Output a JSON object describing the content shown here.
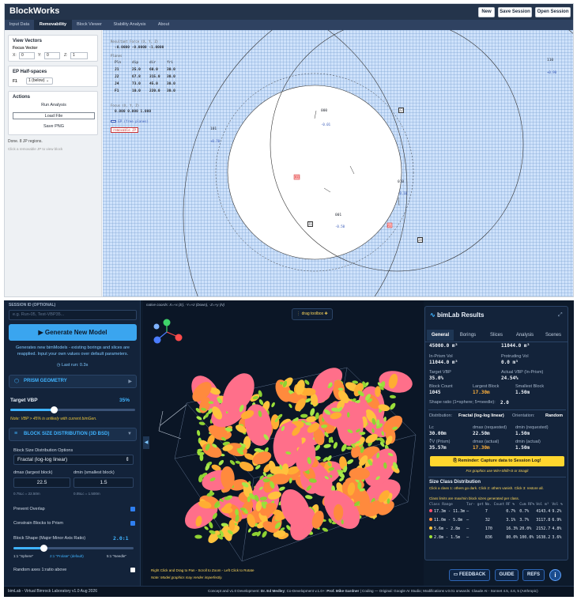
{
  "blockworks": {
    "brand": "BlockWorks",
    "header_buttons": [
      "New",
      "Save Session",
      "Open Session"
    ],
    "tabs": [
      "Input Data",
      "Removability",
      "Block Viewer",
      "Stability Analysis",
      "About"
    ],
    "active_tab": "Removability",
    "view_vectors": {
      "title": "View Vectors",
      "focus_label": "Focus Vector",
      "x_label": "X:",
      "x": "0",
      "y_label": "Y:",
      "y": "0",
      "z_label": "Z:",
      "z": "1"
    },
    "ep": {
      "title": "EP Half-spaces",
      "f1_label": "F1",
      "f1_value": "1 (below)"
    },
    "actions": {
      "title": "Actions",
      "run": "Run Analysis",
      "load": "Load File",
      "save_png": "Save PNG"
    },
    "status": "Done. 8 JP regions.",
    "hint": "Click a removable JP to view block",
    "info": {
      "resultant_label": "Resultant Force (X, Y, Z)",
      "resultant": "-0.0000   -0.0000   -1.0000",
      "planes_label": "Planes",
      "headers": [
        "Pln",
        "dip",
        "dir",
        "fri"
      ],
      "rows": [
        [
          "J1",
          "25.0",
          "60.0",
          "30.0"
        ],
        [
          "J2",
          "67.8",
          "315.0",
          "30.0"
        ],
        [
          "J4",
          "73.0",
          "45.0",
          "30.0"
        ],
        [
          "F1",
          "10.0",
          "220.0",
          "30.0"
        ]
      ],
      "focus_label": "Focus (X, Y, Z)",
      "focus": "0.000  0.000  1.000",
      "ep_legend": "EP (free planes)",
      "removable_legend": "removable JP"
    },
    "plot_labels": [
      {
        "t": "110",
        "id": "l110"
      },
      {
        "t": "+0.90",
        "id": "l090"
      },
      {
        "t": "000",
        "id": "l000"
      },
      {
        "t": "-0.01",
        "id": "l001"
      },
      {
        "t": "J2",
        "id": "lj2"
      },
      {
        "t": "101",
        "id": "l101"
      },
      {
        "t": "+0.70",
        "id": "l070"
      },
      {
        "t": "001",
        "id": "l001b"
      },
      {
        "t": "010",
        "id": "l010"
      },
      {
        "t": "-0.10",
        "id": "l010b"
      },
      {
        "t": "011",
        "id": "l011"
      },
      {
        "t": "-0.50",
        "id": "l050"
      },
      {
        "t": "J1",
        "id": "lj1"
      },
      {
        "t": "F1",
        "id": "lf1"
      },
      {
        "t": "J4",
        "id": "lj4"
      }
    ]
  },
  "bimlab": {
    "session_label": "SESSION ID (OPTIONAL)",
    "session_placeholder": "e.g. Run-05, Test-VBP35...",
    "generate": "Generate New Model",
    "generate_note": "Generates new bimModels - existing borings and slices are reapplied. Input your own values over default parameters.",
    "last_run": "Last run: 0.3s",
    "prism_section": "PRISM GEOMETRY",
    "target_vbp_label": "Target VBP",
    "target_vbp": "35%",
    "target_vbp_fraction": 0.35,
    "vbp_note": "Note: VBP > 45% is unlikely with current bimGen.",
    "bsd_section": "BLOCK SIZE DISTRIBUTION (3D BSD)",
    "bsd_options_label": "Block Size Distribution Options",
    "bsd_select": "Fractal (log-log linear)",
    "dmax_label": "dmax (largest block)",
    "dmax": "22.5",
    "dmax_hint": "0.75Lc = 22.50m",
    "dmin_label": "dmin (smallest block)",
    "dmin": "1.5",
    "dmin_hint": "0.05Lc = 1.500m",
    "prevent_overlap": "Prevent Overlap",
    "constrain": "Constrain Blocks to Prism",
    "shape_label": "Block Shape (Major:Minor Axis Ratio)",
    "shape_value": "2.0:1",
    "shape_fraction": 0.25,
    "shape_ticks": [
      "1:1 \"Sphere\"",
      "2:1 \"Prolate\" (default)",
      "5:1 \"Needle\""
    ],
    "random_axes": "Random axes 1:ratio above",
    "footer_left": "bimLab - Virtual Bimrock Laboratory v1.0 Aug 2026",
    "footer_right_1": "Concept and v1.0 Development: ",
    "footer_right_name1": "Dr. Ed Medley",
    "footer_right_2": "; Co-Development v.1.0+: ",
    "footer_right_name2": "Prof. Mike Gardner",
    "footer_right_3": " | Coding — Original: Google AI Studio; Modifications v.0.01 onwards: Claude AI - Sonnet 4.5, 4.6, 5 (Anthropic)",
    "view": {
      "coords_hint": "native coords: X=+x (E), -Y=+z (Down), -Z=+y (N)",
      "toolbox": "drag toolbox",
      "axis_labels": [
        "Y",
        "X",
        "Z",
        "X"
      ],
      "controls_hint": "Right Click and Drag to Pan - Scroll to Zoom - Left Click to Rotate",
      "model_note": "Note: Model graphics may render imperfectly."
    },
    "results": {
      "title": "bimLab Results",
      "tabs": [
        "General",
        "Borings",
        "Slices",
        "Analysis",
        "Scenes"
      ],
      "active_tab": "General",
      "top_left": "45000.0 m³",
      "top_right": "11044.0 m³",
      "in_prism_label": "In-Prism Vol",
      "in_prism": "11044.0 m³",
      "protruding_label": "Protruding Vol",
      "protruding": "0.0 m³",
      "target_vbp_label": "Target VBP",
      "target_vbp": "35.0%",
      "actual_vbp_label": "Actual VBP (In-Prism)",
      "actual_vbp": "24.54%",
      "block_count_label": "Block Count",
      "block_count": "1045",
      "largest_label": "Largest Block",
      "largest": "17.30m",
      "smallest_label": "Smallest Block",
      "smallest": "1.50m",
      "shape_ratio_label": "Shape ratio (1=sphere; 5=needle):",
      "shape_ratio": "2.0",
      "distribution_label": "Distribution:",
      "distribution": "Fractal (log-log linear)",
      "orientation_label": "Orientation:",
      "orientation": "Random",
      "lc_label": "Lc",
      "lc": "30.00m",
      "dmax_req_label": "dmax (requested)",
      "dmax_req": "22.50m",
      "dmin_req_label": "dmin (requested)",
      "dmin_req": "1.50m",
      "cbrt_label": "∛V (Prism)",
      "cbrt": "35.57m",
      "dmax_act_label": "dmax (actual)",
      "dmax_act": "17.30m",
      "dmin_act_label": "dmin (actual)",
      "dmin_act": "1.50m",
      "reminder": "Reminder: Capture data to Session Log!",
      "graphics_note": "For graphics use Win+Shift+S or Snagit",
      "size_title": "Size Class Distribution",
      "size_note1": "Click a class 1: others go dark. Click 2: others vanish. Click 3: restore all.",
      "size_note2": "Class limits are max/min block sizes generated per class.",
      "size_headers": [
        "Class Range",
        "Tar- get",
        "No. Count",
        "RF %",
        "Cum RF%",
        "Vol m³",
        "Vol %"
      ],
      "size_rows": [
        {
          "range": "17.3m - 11.3m",
          "target": "—",
          "count": "7",
          "rf": "0.7%",
          "cum": "0.7%",
          "vol": "4143.4",
          "volp": "9.2%",
          "color": "#ff4d6d"
        },
        {
          "range": "11.0m - 5.8m",
          "target": "—",
          "count": "32",
          "rf": "3.1%",
          "cum": "3.7%",
          "vol": "3117.8",
          "volp": "6.9%",
          "color": "#ff8a3d"
        },
        {
          "range": "5.6m - 2.8m",
          "target": "—",
          "count": "170",
          "rf": "16.3%",
          "cum": "20.0%",
          "vol": "2152.7",
          "volp": "4.8%",
          "color": "#ffc23d"
        },
        {
          "range": "2.8m - 1.5m",
          "target": "—",
          "count": "836",
          "rf": "80.0%",
          "cum": "100.0%",
          "vol": "1638.2",
          "volp": "3.6%",
          "color": "#9be03a"
        }
      ]
    },
    "footer_buttons": [
      "FEEDBACK",
      "GUIDE",
      "REFS"
    ]
  }
}
